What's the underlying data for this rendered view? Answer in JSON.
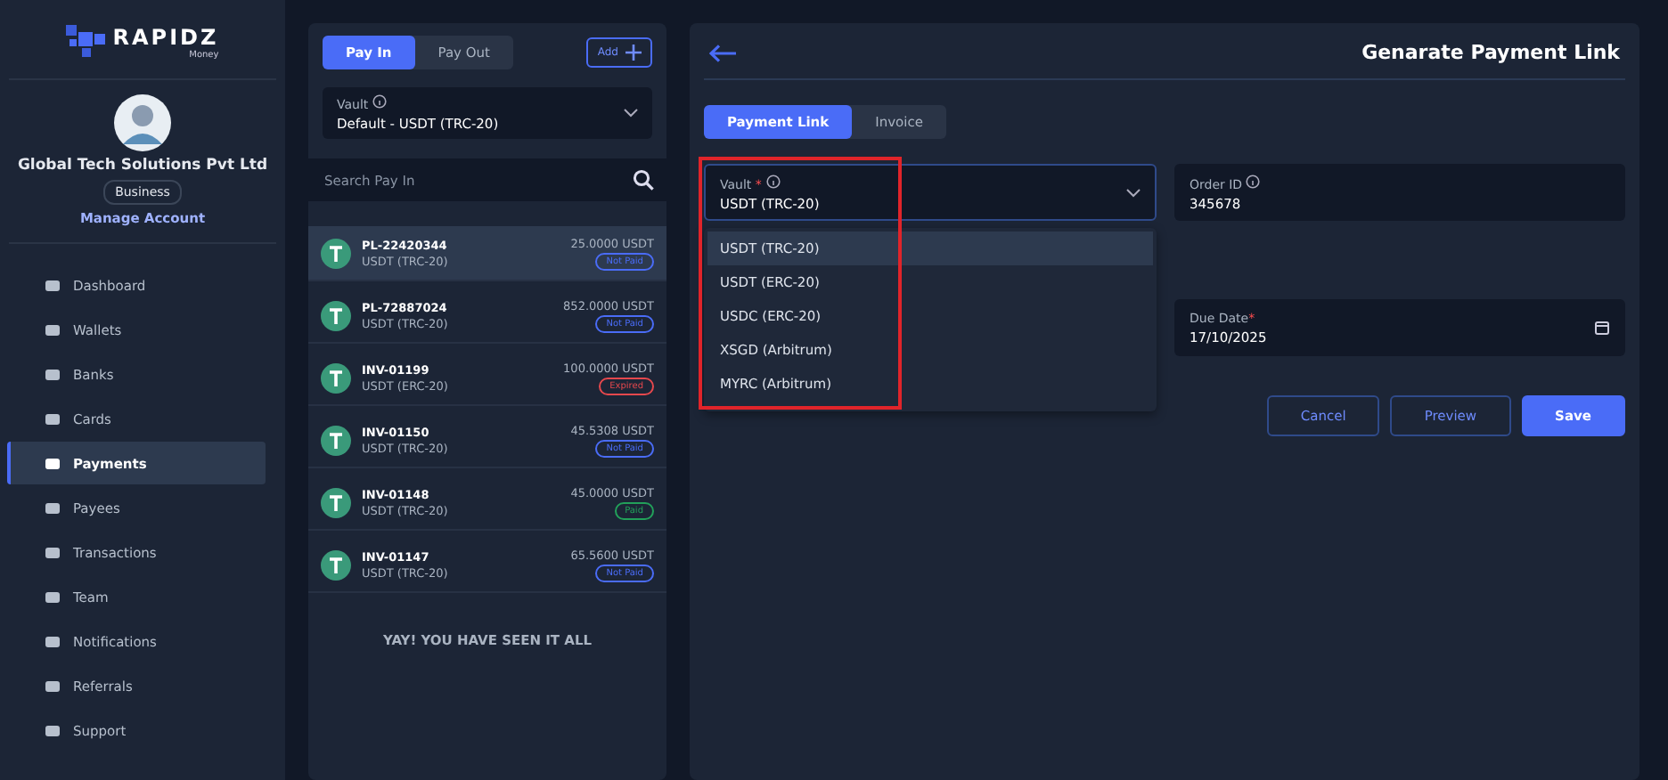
{
  "brand": {
    "name": "RAPIDZ",
    "sub": "Money"
  },
  "profile": {
    "company": "Global Tech Solutions Pvt Ltd",
    "badge": "Business",
    "link": "Manage Account"
  },
  "sidebar": {
    "items": [
      {
        "label": "Dashboard",
        "selected": false
      },
      {
        "label": "Wallets",
        "selected": false
      },
      {
        "label": "Banks",
        "selected": false
      },
      {
        "label": "Cards",
        "selected": false
      },
      {
        "label": "Payments",
        "selected": true
      },
      {
        "label": "Payees",
        "selected": false
      },
      {
        "label": "Transactions",
        "selected": false
      },
      {
        "label": "Team",
        "selected": false
      },
      {
        "label": "Notifications",
        "selected": false
      },
      {
        "label": "Referrals",
        "selected": false
      },
      {
        "label": "Support",
        "selected": false
      }
    ]
  },
  "list_panel": {
    "tabs": [
      {
        "label": "Pay In",
        "selected": true
      },
      {
        "label": "Pay Out",
        "selected": false
      }
    ],
    "add_button": "Add",
    "vault": {
      "label": "Vault",
      "value": "Default - USDT (TRC-20)"
    },
    "search": {
      "placeholder": "Search Pay In"
    },
    "rows": [
      {
        "id": "PL-22420344",
        "network": "USDT (TRC-20)",
        "amount": "25.0000 USDT",
        "status": {
          "label": "Not Paid",
          "color": "#4a6cf7"
        },
        "selected": true
      },
      {
        "id": "PL-72887024",
        "network": "USDT (TRC-20)",
        "amount": "852.0000 USDT",
        "status": {
          "label": "Not Paid",
          "color": "#4a6cf7"
        },
        "selected": false
      },
      {
        "id": "INV-01199",
        "network": "USDT (ERC-20)",
        "amount": "100.0000 USDT",
        "status": {
          "label": "Expired",
          "color": "#e5484d"
        },
        "selected": false
      },
      {
        "id": "INV-01150",
        "network": "USDT (TRC-20)",
        "amount": "45.5308 USDT",
        "status": {
          "label": "Not Paid",
          "color": "#4a6cf7"
        },
        "selected": false
      },
      {
        "id": "INV-01148",
        "network": "USDT (TRC-20)",
        "amount": "45.0000 USDT",
        "status": {
          "label": "Paid",
          "color": "#22a05a"
        },
        "selected": false
      },
      {
        "id": "INV-01147",
        "network": "USDT (TRC-20)",
        "amount": "65.5600 USDT",
        "status": {
          "label": "Not Paid",
          "color": "#4a6cf7"
        },
        "selected": false
      }
    ],
    "end_message": "YAY! YOU HAVE SEEN IT ALL"
  },
  "form": {
    "title": "Genarate Payment Link",
    "tabs": [
      {
        "label": "Payment Link",
        "selected": true
      },
      {
        "label": "Invoice",
        "selected": false
      }
    ],
    "vault": {
      "label": "Vault",
      "required_mark": "*",
      "value": "USDT (TRC-20)",
      "expanded": true,
      "options": [
        {
          "label": "USDT (TRC-20)",
          "selected": true
        },
        {
          "label": "USDT (ERC-20)",
          "selected": false
        },
        {
          "label": "USDC (ERC-20)",
          "selected": false
        },
        {
          "label": "XSGD (Arbitrum)",
          "selected": false
        },
        {
          "label": "MYRC (Arbitrum)",
          "selected": false
        }
      ]
    },
    "order_id": {
      "label": "Order ID",
      "value": "345678"
    },
    "due_date": {
      "label": "Due Date",
      "required_mark": "*",
      "value": "17/10/2025"
    },
    "buttons": [
      "Cancel",
      "Preview",
      "Save"
    ]
  }
}
